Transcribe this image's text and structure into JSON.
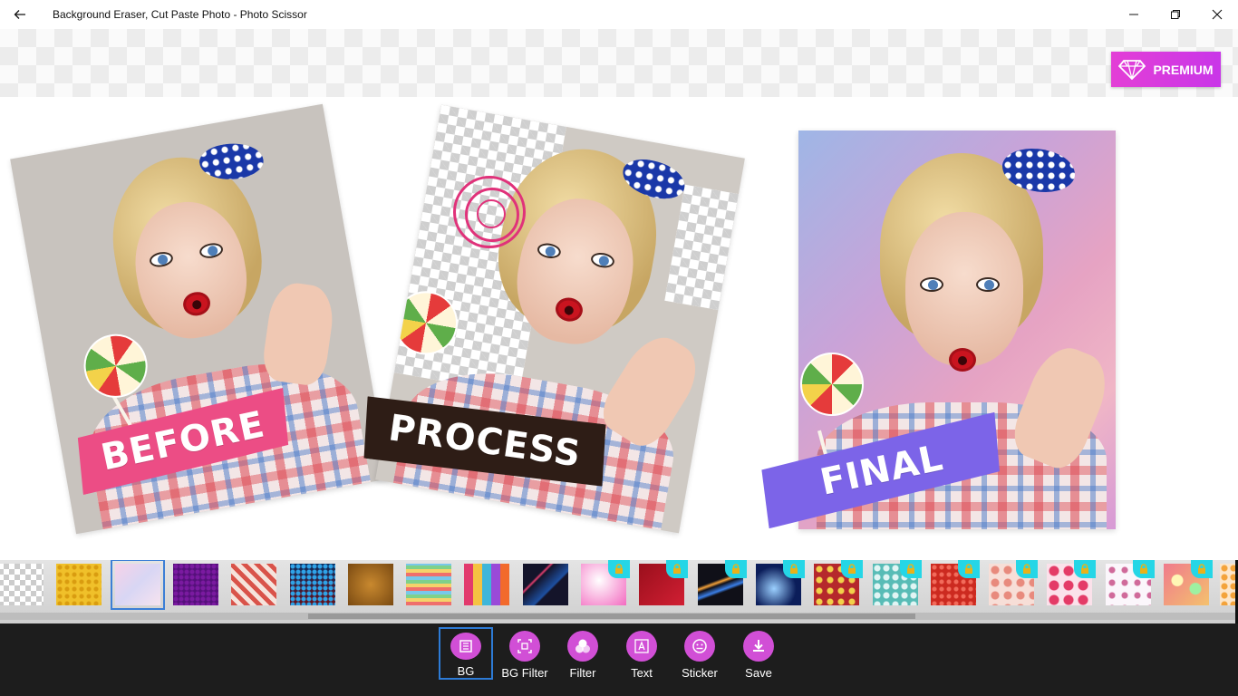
{
  "titlebar": {
    "title": "Background Eraser, Cut Paste Photo - Photo Scissor"
  },
  "premium": {
    "label": "PREMIUM"
  },
  "showcase": {
    "before_label": "BEFORE",
    "process_label": "PROCESS",
    "final_label": "FINAL"
  },
  "colors": {
    "accent": "#d14fd6",
    "premium_gradient_start": "#e33fd6",
    "premium_gradient_end": "#c936e8",
    "before_stamp": "#ec4d85",
    "process_stamp": "#2e1d16",
    "final_stamp": "#7c64e8",
    "lock_badge": "#25d6e6",
    "selection": "#3c7fd6",
    "toolbar_bg": "#1d1d1d"
  },
  "backgrounds": [
    {
      "id": "transparent",
      "locked": false,
      "selected": false
    },
    {
      "id": "yellow-pattern",
      "locked": false,
      "selected": false
    },
    {
      "id": "pastel-watercolor",
      "locked": false,
      "selected": true
    },
    {
      "id": "purple",
      "locked": false,
      "selected": false
    },
    {
      "id": "red-geometric",
      "locked": false,
      "selected": false
    },
    {
      "id": "blue-halftone",
      "locked": false,
      "selected": false
    },
    {
      "id": "brown-texture",
      "locked": false,
      "selected": false
    },
    {
      "id": "rainbow-waves",
      "locked": false,
      "selected": false
    },
    {
      "id": "color-pixels",
      "locked": false,
      "selected": false
    },
    {
      "id": "dark-streaks",
      "locked": false,
      "selected": false
    },
    {
      "id": "pink-light",
      "locked": true,
      "selected": false
    },
    {
      "id": "red-velvet",
      "locked": true,
      "selected": false
    },
    {
      "id": "light-trails",
      "locked": true,
      "selected": false
    },
    {
      "id": "lightning",
      "locked": true,
      "selected": false
    },
    {
      "id": "paisley",
      "locked": true,
      "selected": false
    },
    {
      "id": "teal-pattern",
      "locked": true,
      "selected": false
    },
    {
      "id": "red-dots",
      "locked": true,
      "selected": false
    },
    {
      "id": "peach-floral",
      "locked": true,
      "selected": false
    },
    {
      "id": "pink-roses",
      "locked": true,
      "selected": false
    },
    {
      "id": "white-floral",
      "locked": true,
      "selected": false
    },
    {
      "id": "bokeh",
      "locked": true,
      "selected": false
    }
  ],
  "toolbar": {
    "items": [
      {
        "label": "BG",
        "icon": "layers-icon",
        "active": true
      },
      {
        "label": "BG Filter",
        "icon": "image-filter-icon",
        "active": false
      },
      {
        "label": "Filter",
        "icon": "color-circles-icon",
        "active": false
      },
      {
        "label": "Text",
        "icon": "text-frame-icon",
        "active": false
      },
      {
        "label": "Sticker",
        "icon": "smiley-icon",
        "active": false
      },
      {
        "label": "Save",
        "icon": "download-icon",
        "active": false
      }
    ]
  }
}
